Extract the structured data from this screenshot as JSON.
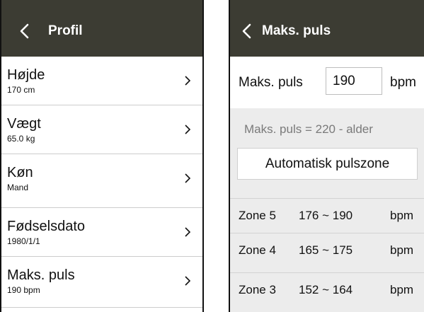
{
  "profile": {
    "title": "Profil",
    "items": [
      {
        "label": "Højde",
        "value": "170 cm"
      },
      {
        "label": "Vægt",
        "value": "65.0 kg"
      },
      {
        "label": "Køn",
        "value": "Mand"
      },
      {
        "label": "Fødselsdato",
        "value": "1980/1/1"
      },
      {
        "label": "Maks. puls",
        "value": "190 bpm"
      }
    ]
  },
  "max_pulse": {
    "title": "Maks. puls",
    "field_label": "Maks. puls",
    "field_value": "190",
    "unit": "bpm",
    "formula": "Maks. puls = 220 - alder",
    "auto_button": "Automatisk pulszone",
    "zones": [
      {
        "name": "Zone 5",
        "range": "176 ~ 190",
        "unit": "bpm"
      },
      {
        "name": "Zone 4",
        "range": "165 ~ 175",
        "unit": "bpm"
      },
      {
        "name": "Zone 3",
        "range": "152 ~ 164",
        "unit": "bpm"
      }
    ]
  },
  "colors": {
    "header_bg": "#3c3c33",
    "header_text": "#ffffff",
    "panel_grey": "#ececec",
    "caret": "#e8a06a"
  },
  "icons": {
    "back": "chevron-left-icon",
    "row": "chevron-right-icon"
  }
}
